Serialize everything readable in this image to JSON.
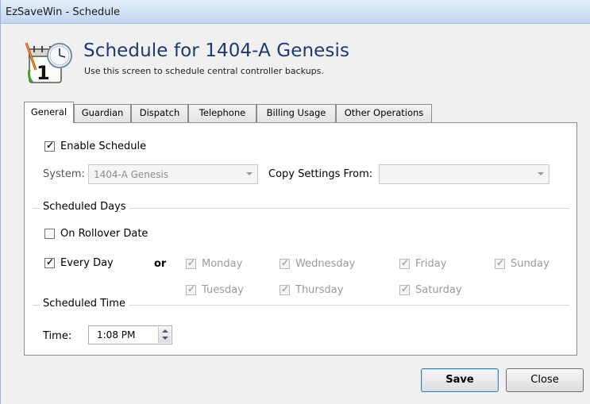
{
  "window": {
    "title": "EzSaveWin - Schedule"
  },
  "header": {
    "title": "Schedule for 1404-A Genesis",
    "subtitle": "Use this screen to schedule central controller backups.",
    "icon": "calendar-clock-icon"
  },
  "tabs": [
    {
      "label": "General",
      "active": true
    },
    {
      "label": "Guardian",
      "active": false
    },
    {
      "label": "Dispatch",
      "active": false
    },
    {
      "label": "Telephone",
      "active": false
    },
    {
      "label": "Billing Usage",
      "active": false
    },
    {
      "label": "Other Operations",
      "active": false
    }
  ],
  "general": {
    "enable_schedule": {
      "label": "Enable Schedule",
      "checked": true
    },
    "system": {
      "label": "System:",
      "value": "1404-A Genesis"
    },
    "copy_settings": {
      "label": "Copy Settings From:",
      "value": ""
    },
    "scheduled_days": {
      "title": "Scheduled Days",
      "on_rollover": {
        "label": "On Rollover Date",
        "checked": false
      },
      "every_day": {
        "label": "Every Day",
        "checked": true
      },
      "or_label": "or",
      "days": {
        "monday": {
          "label": "Monday",
          "checked": true
        },
        "tuesday": {
          "label": "Tuesday",
          "checked": true
        },
        "wednesday": {
          "label": "Wednesday",
          "checked": true
        },
        "thursday": {
          "label": "Thursday",
          "checked": true
        },
        "friday": {
          "label": "Friday",
          "checked": true
        },
        "saturday": {
          "label": "Saturday",
          "checked": true
        },
        "sunday": {
          "label": "Sunday",
          "checked": true
        }
      }
    },
    "scheduled_time": {
      "title": "Scheduled Time",
      "time_label": "Time:",
      "time_value": "1:08 PM"
    }
  },
  "buttons": {
    "save": "Save",
    "close": "Close"
  }
}
